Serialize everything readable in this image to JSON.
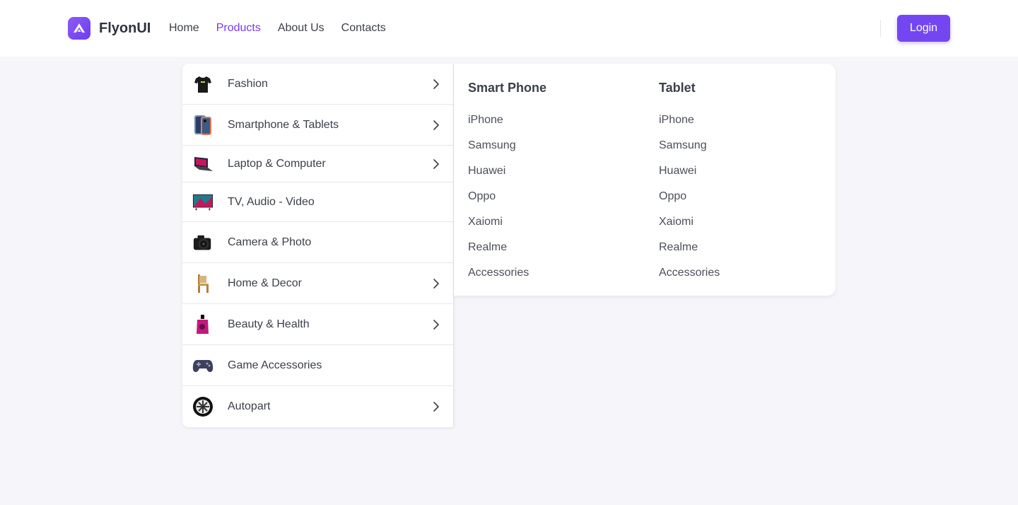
{
  "brand": {
    "name": "FlyonUI",
    "logo_icon": "flyonui-logo-icon"
  },
  "nav": {
    "links": [
      {
        "label": "Home",
        "active": false
      },
      {
        "label": "Products",
        "active": true
      },
      {
        "label": "About Us",
        "active": false
      },
      {
        "label": "Contacts",
        "active": false
      }
    ],
    "login_label": "Login"
  },
  "colors": {
    "accent": "#7346f2",
    "active_link": "#7c3aed",
    "page_bg": "#f6f6fa"
  },
  "categories": [
    {
      "label": "Fashion",
      "icon": "tshirt-icon",
      "has_submenu": true
    },
    {
      "label": "Smartphone & Tablets",
      "icon": "smartphone-icon",
      "has_submenu": true
    },
    {
      "label": "Laptop & Computer",
      "icon": "laptop-icon",
      "has_submenu": true
    },
    {
      "label": "TV, Audio - Video",
      "icon": "tv-icon",
      "has_submenu": false
    },
    {
      "label": "Camera & Photo",
      "icon": "camera-icon",
      "has_submenu": false
    },
    {
      "label": "Home & Decor",
      "icon": "chair-icon",
      "has_submenu": true
    },
    {
      "label": "Beauty & Health",
      "icon": "perfume-icon",
      "has_submenu": true
    },
    {
      "label": "Game Accessories",
      "icon": "gamepad-icon",
      "has_submenu": false
    },
    {
      "label": "Autopart",
      "icon": "wheel-icon",
      "has_submenu": true
    }
  ],
  "submenu": {
    "columns": [
      {
        "title": "Smart Phone",
        "links": [
          "iPhone",
          "Samsung",
          "Huawei",
          "Oppo",
          "Xaiomi",
          "Realme",
          "Accessories"
        ]
      },
      {
        "title": "Tablet",
        "links": [
          "iPhone",
          "Samsung",
          "Huawei",
          "Oppo",
          "Xaiomi",
          "Realme",
          "Accessories"
        ]
      }
    ]
  }
}
